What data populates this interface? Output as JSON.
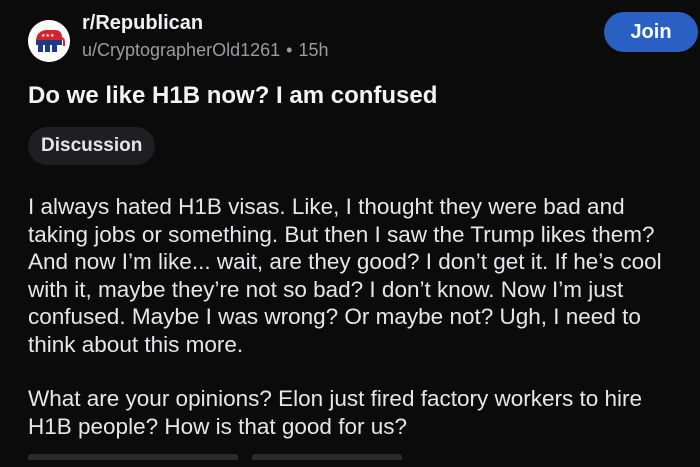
{
  "post": {
    "subreddit": "r/Republican",
    "author": "u/CryptographerOld1261",
    "separator": "•",
    "age": "15h",
    "join_label": "Join",
    "title": "Do we like H1B now? I am confused",
    "flair": "Discussion",
    "body": [
      "I always hated H1B visas. Like, I thought they were bad and taking jobs or something. But then I saw the Trump likes them? And now I’m like... wait, are they good? I don’t get it. If he’s cool with it, maybe they’re not so bad? I don’t know. Now I’m just confused. Maybe I was wrong? Or maybe not? Ugh, I need to think about this more.",
      "What are your opinions? Elon just fired factory workers to hire H1B people? How is that good for us?"
    ]
  },
  "colors": {
    "background": "#0b0b0c",
    "join_button": "#2a5fc4",
    "flair_bg": "#1f1f22",
    "muted_text": "#9b9ca1",
    "subreddit_icon_red": "#d0252b",
    "subreddit_icon_blue": "#1d3a8a"
  },
  "icons": {
    "subreddit_avatar": "republican-elephant-icon"
  }
}
